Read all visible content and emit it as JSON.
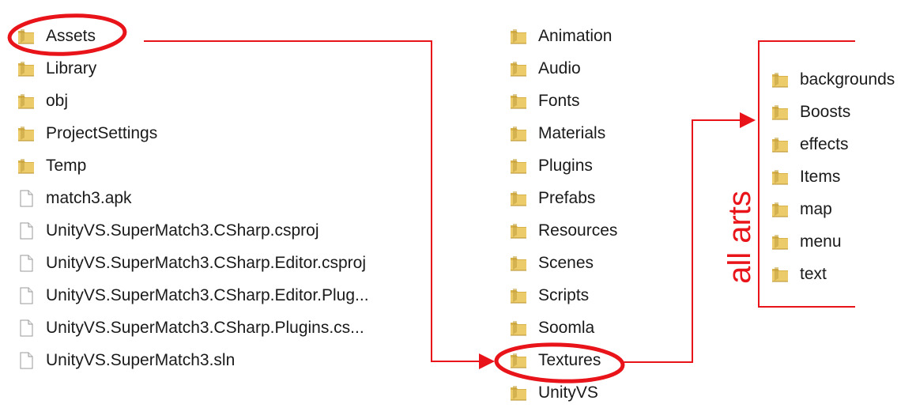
{
  "colors": {
    "annotation_red": "#e8141a",
    "folder_yellow": "#eccb6a",
    "file_gray": "#9a9a9a"
  },
  "left_column": {
    "items": [
      {
        "label": "Assets",
        "icon": "folder-icon",
        "type": "folder"
      },
      {
        "label": "Library",
        "icon": "folder-icon",
        "type": "folder"
      },
      {
        "label": "obj",
        "icon": "folder-icon",
        "type": "folder"
      },
      {
        "label": "ProjectSettings",
        "icon": "folder-icon",
        "type": "folder"
      },
      {
        "label": "Temp",
        "icon": "folder-icon",
        "type": "folder"
      },
      {
        "label": "match3.apk",
        "icon": "file-icon",
        "type": "file"
      },
      {
        "label": "UnityVS.SuperMatch3.CSharp.csproj",
        "icon": "file-icon",
        "type": "file"
      },
      {
        "label": "UnityVS.SuperMatch3.CSharp.Editor.csproj",
        "icon": "file-icon",
        "type": "file"
      },
      {
        "label": "UnityVS.SuperMatch3.CSharp.Editor.Plug...",
        "icon": "file-icon",
        "type": "file"
      },
      {
        "label": "UnityVS.SuperMatch3.CSharp.Plugins.cs...",
        "icon": "file-icon",
        "type": "file"
      },
      {
        "label": "UnityVS.SuperMatch3.sln",
        "icon": "file-icon",
        "type": "file"
      }
    ]
  },
  "middle_column": {
    "items": [
      {
        "label": "Animation",
        "icon": "folder-icon",
        "type": "folder"
      },
      {
        "label": "Audio",
        "icon": "folder-icon",
        "type": "folder"
      },
      {
        "label": "Fonts",
        "icon": "folder-icon",
        "type": "folder"
      },
      {
        "label": "Materials",
        "icon": "folder-icon",
        "type": "folder"
      },
      {
        "label": "Plugins",
        "icon": "folder-icon",
        "type": "folder"
      },
      {
        "label": "Prefabs",
        "icon": "folder-icon",
        "type": "folder"
      },
      {
        "label": "Resources",
        "icon": "folder-icon",
        "type": "folder"
      },
      {
        "label": "Scenes",
        "icon": "folder-icon",
        "type": "folder"
      },
      {
        "label": "Scripts",
        "icon": "folder-icon",
        "type": "folder"
      },
      {
        "label": "Soomla",
        "icon": "folder-icon",
        "type": "folder"
      },
      {
        "label": "Textures",
        "icon": "folder-icon",
        "type": "folder"
      },
      {
        "label": "UnityVS",
        "icon": "folder-icon",
        "type": "folder"
      }
    ]
  },
  "right_column": {
    "items": [
      {
        "label": "backgrounds",
        "icon": "folder-icon",
        "type": "folder"
      },
      {
        "label": "Boosts",
        "icon": "folder-icon",
        "type": "folder"
      },
      {
        "label": "effects",
        "icon": "folder-icon",
        "type": "folder"
      },
      {
        "label": "Items",
        "icon": "folder-icon",
        "type": "folder"
      },
      {
        "label": "map",
        "icon": "folder-icon",
        "type": "folder"
      },
      {
        "label": "menu",
        "icon": "folder-icon",
        "type": "folder"
      },
      {
        "label": "text",
        "icon": "folder-icon",
        "type": "folder"
      }
    ]
  },
  "annotations": {
    "highlighted": [
      "Assets",
      "Textures"
    ],
    "bracket_label": "all arts"
  }
}
